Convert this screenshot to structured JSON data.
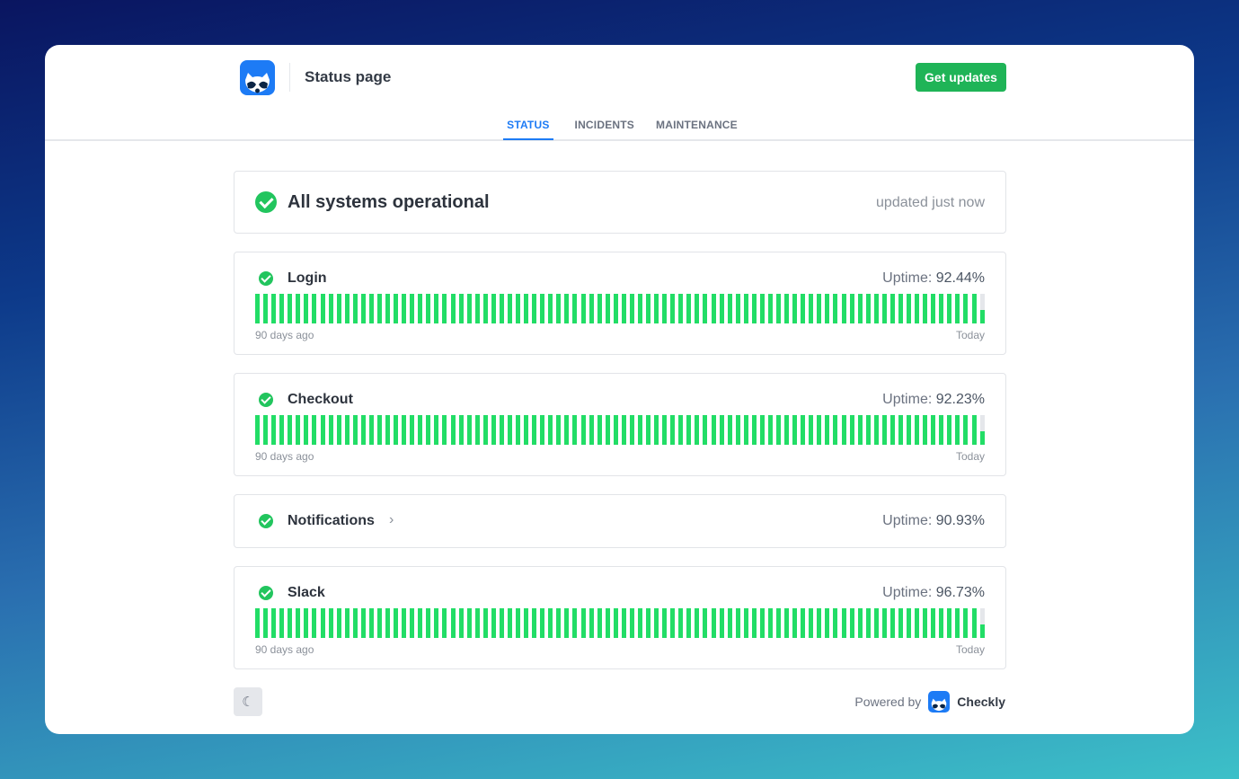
{
  "header": {
    "title": "Status page",
    "cta": "Get updates"
  },
  "tabs": [
    {
      "label": "STATUS",
      "active": true
    },
    {
      "label": "INCIDENTS"
    },
    {
      "label": "MAINTENANCE"
    }
  ],
  "summary": {
    "status": "All systems operational",
    "updated": "updated just now"
  },
  "uptime_prefix": "Uptime: ",
  "monitors": [
    {
      "name": "Login",
      "uptime": "92.44%",
      "days": 90,
      "last_day_fraction": 0.45,
      "start": "90 days ago",
      "end": "Today"
    },
    {
      "name": "Checkout",
      "uptime": "92.23%",
      "days": 90,
      "last_day_fraction": 0.45,
      "start": "90 days ago",
      "end": "Today"
    },
    {
      "name": "Notifications",
      "uptime": "90.93%",
      "collapsed": true
    },
    {
      "name": "Slack",
      "uptime": "96.73%",
      "days": 90,
      "last_day_fraction": 0.45,
      "start": "90 days ago",
      "end": "Today"
    }
  ],
  "footer": {
    "powered_by": "Powered by",
    "brand": "Checkly",
    "theme_icon": "moon-icon"
  },
  "colors": {
    "up": "#22dd66",
    "accent": "#1d7bf5",
    "cta": "#1fb457"
  }
}
